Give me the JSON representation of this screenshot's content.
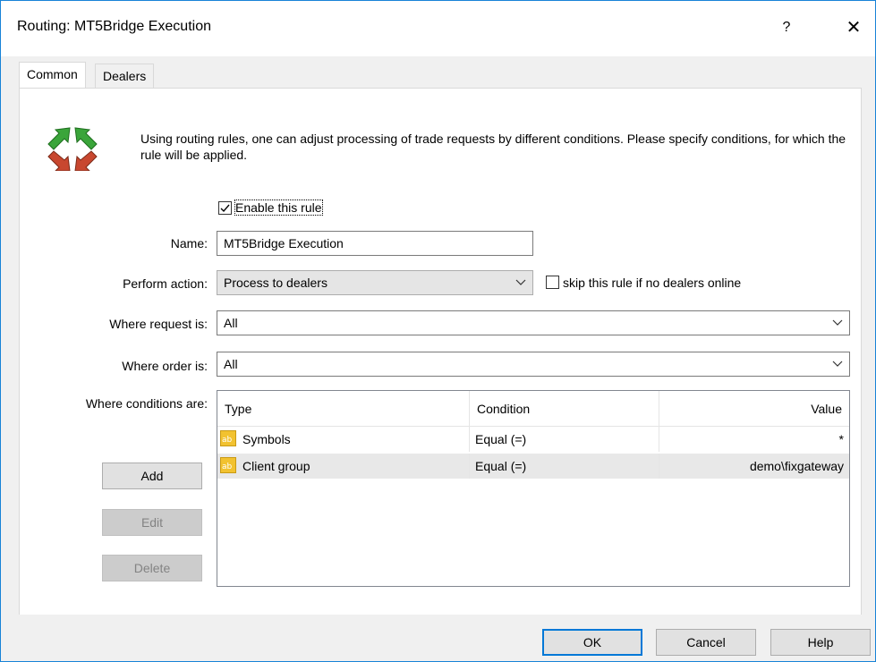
{
  "window": {
    "title": "Routing: MT5Bridge Execution",
    "help_glyph": "?",
    "close_glyph": "✕"
  },
  "tabs": [
    {
      "label": "Common",
      "active": true
    },
    {
      "label": "Dealers",
      "active": false
    }
  ],
  "description": "Using routing rules, one can adjust processing of trade requests by different conditions. Please specify conditions, for which the rule will be applied.",
  "enable_rule": {
    "label": "Enable this rule",
    "checked": true
  },
  "name": {
    "label": "Name:",
    "value": "MT5Bridge Execution"
  },
  "perform_action": {
    "label": "Perform action:",
    "value": "Process to dealers"
  },
  "skip_rule": {
    "label": "skip this rule if no dealers online",
    "checked": false
  },
  "where_request": {
    "label": "Where request is:",
    "value": "All"
  },
  "where_order": {
    "label": "Where order is:",
    "value": "All"
  },
  "conditions": {
    "label": "Where conditions are:",
    "columns": [
      "Type",
      "Condition",
      "Value"
    ],
    "rows": [
      {
        "type": "Symbols",
        "condition": "Equal (=)",
        "value": "*",
        "selected": false
      },
      {
        "type": "Client group",
        "condition": "Equal (=)",
        "value": "demo\\fixgateway",
        "selected": true
      }
    ],
    "icon": "ab-text-icon"
  },
  "side_buttons": {
    "add": "Add",
    "edit": "Edit",
    "delete": "Delete"
  },
  "footer_buttons": {
    "ok": "OK",
    "cancel": "Cancel",
    "help": "Help"
  },
  "colors": {
    "accent": "#0078d7",
    "icon_arrow_green": "#3aa53a",
    "icon_arrow_red": "#c8472f",
    "ab_icon": "#f2c230"
  }
}
